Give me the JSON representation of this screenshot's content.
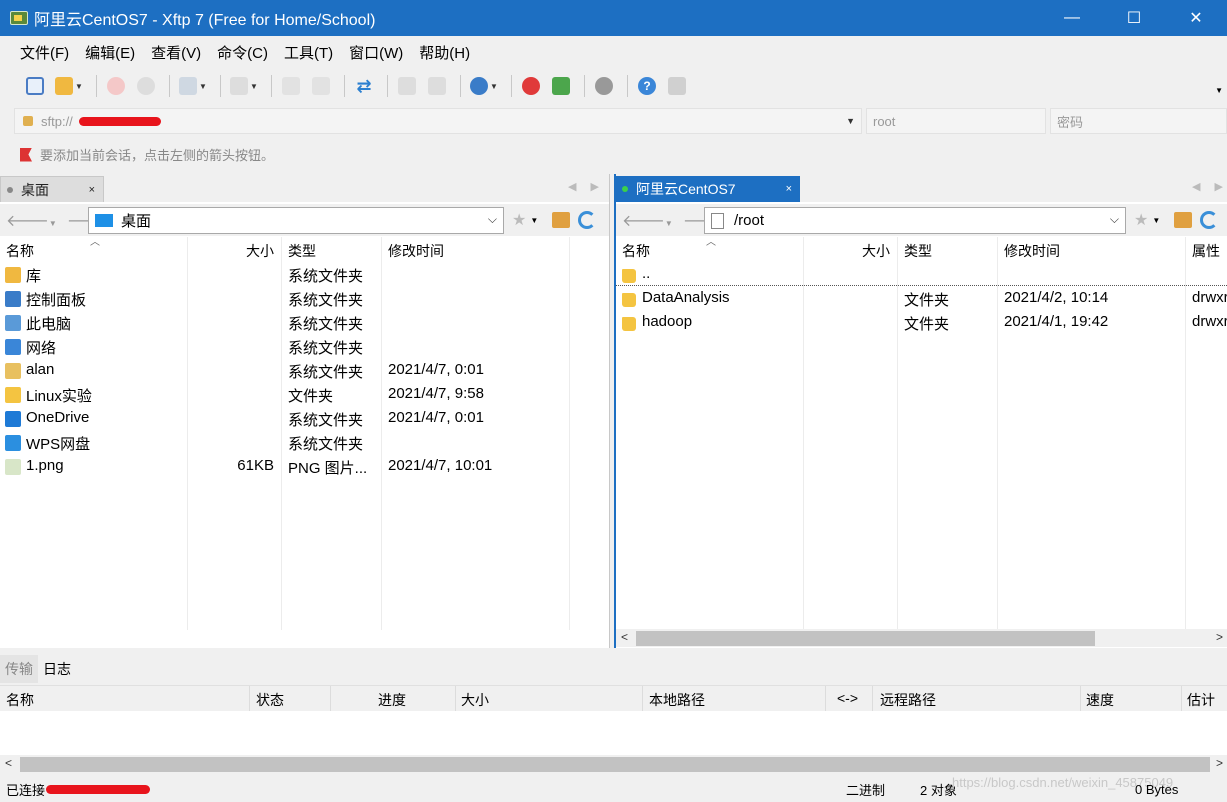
{
  "window": {
    "title": "阿里云CentOS7 - Xftp 7 (Free for Home/School)",
    "controls": {
      "minimize": "—",
      "maximize": "☐",
      "close": "✕"
    }
  },
  "menu": [
    "文件(F)",
    "编辑(E)",
    "查看(V)",
    "命令(C)",
    "工具(T)",
    "窗口(W)",
    "帮助(H)"
  ],
  "address": {
    "url_prefix": "sftp://",
    "user_placeholder": "root",
    "password_placeholder": "密码"
  },
  "hint": "要添加当前会话，点击左侧的箭头按钮。",
  "left_panel": {
    "tab_label": "桌面",
    "tab_close": "×",
    "path": "桌面",
    "columns": {
      "name": "名称",
      "size": "大小",
      "type": "类型",
      "modified": "修改时间"
    },
    "rows": [
      {
        "name": "库",
        "size": "",
        "type": "系统文件夹",
        "modified": "",
        "icon": "library-icon"
      },
      {
        "name": "控制面板",
        "size": "",
        "type": "系统文件夹",
        "modified": "",
        "icon": "control-panel-icon"
      },
      {
        "name": "此电脑",
        "size": "",
        "type": "系统文件夹",
        "modified": "",
        "icon": "computer-icon"
      },
      {
        "name": "网络",
        "size": "",
        "type": "系统文件夹",
        "modified": "",
        "icon": "network-icon"
      },
      {
        "name": "alan",
        "size": "",
        "type": "系统文件夹",
        "modified": "2021/4/7, 0:01",
        "icon": "user-folder-icon"
      },
      {
        "name": "Linux实验",
        "size": "",
        "type": "文件夹",
        "modified": "2021/4/7, 9:58",
        "icon": "folder-icon"
      },
      {
        "name": "OneDrive",
        "size": "",
        "type": "系统文件夹",
        "modified": "2021/4/7, 0:01",
        "icon": "onedrive-icon"
      },
      {
        "name": "WPS网盘",
        "size": "",
        "type": "系统文件夹",
        "modified": "",
        "icon": "wps-cloud-icon"
      },
      {
        "name": "1.png",
        "size": "61KB",
        "type": "PNG 图片...",
        "modified": "2021/4/7, 10:01",
        "icon": "png-file-icon"
      }
    ]
  },
  "right_panel": {
    "tab_label": "阿里云CentOS7",
    "tab_close": "×",
    "path": "/root",
    "columns": {
      "name": "名称",
      "size": "大小",
      "type": "类型",
      "modified": "修改时间",
      "attr": "属性"
    },
    "rows": [
      {
        "name": "..",
        "type": "",
        "modified": "",
        "attr": ""
      },
      {
        "name": "DataAnalysis",
        "type": "文件夹",
        "modified": "2021/4/2, 10:14",
        "attr": "drwxr"
      },
      {
        "name": "hadoop",
        "type": "文件夹",
        "modified": "2021/4/1, 19:42",
        "attr": "drwxr"
      }
    ]
  },
  "bottom": {
    "tabs": [
      "传输",
      "日志"
    ],
    "columns": [
      "名称",
      "状态",
      "进度",
      "大小",
      "本地路径",
      "<->",
      "远程路径",
      "速度",
      "估计剩"
    ]
  },
  "status": {
    "connected": "已连接",
    "mode": "二进制",
    "objects": "2 对象",
    "bytes": "0 Bytes",
    "watermark": "https://blog.csdn.net/weixin_45875049"
  }
}
